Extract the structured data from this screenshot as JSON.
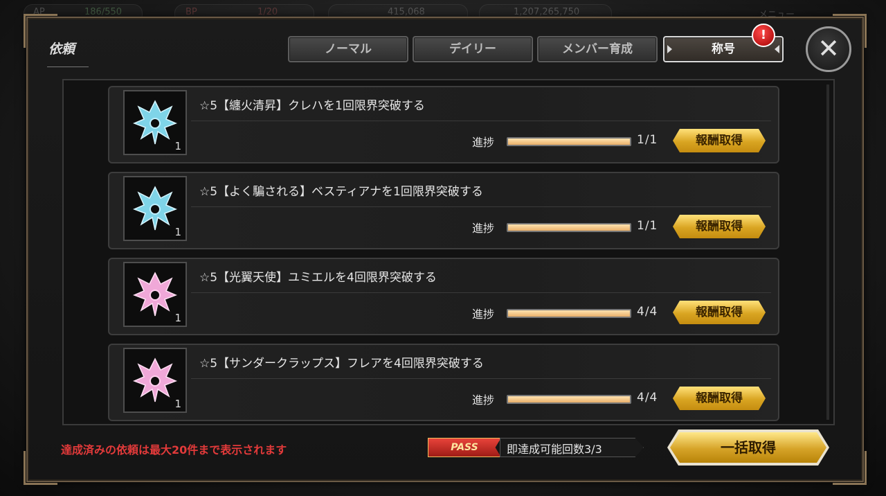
{
  "background_hud": {
    "ap_label": "AP",
    "ap_value": "186/550",
    "bp_label": "BP",
    "bp_value": "1/20",
    "currency_1": "415,068",
    "currency_2": "1,207,265,750",
    "menu_label": "メニュー"
  },
  "dialog": {
    "title": "依頼",
    "tabs": [
      {
        "label": "ノーマル",
        "active": false
      },
      {
        "label": "デイリー",
        "active": false
      },
      {
        "label": "メンバー育成",
        "active": false
      },
      {
        "label": "称号",
        "active": true
      }
    ],
    "alert_glyph": "!",
    "close_glyph": "✕"
  },
  "quests": [
    {
      "description": "☆5【纏火清昇】クレハを1回限界突破する",
      "icon": "crest-blue-icon",
      "icon_color": "#7fd4e8",
      "quantity": "1",
      "progress_label": "進捗",
      "progress_text": "1/1",
      "progress_fraction": 1.0,
      "claim_label": "報酬取得"
    },
    {
      "description": "☆5【よく騙される】ベスティアナを1回限界突破する",
      "icon": "crest-blue-icon",
      "icon_color": "#7fd4e8",
      "quantity": "1",
      "progress_label": "進捗",
      "progress_text": "1/1",
      "progress_fraction": 1.0,
      "claim_label": "報酬取得"
    },
    {
      "description": "☆5【光翼天使】ユミエルを4回限界突破する",
      "icon": "crest-pink-icon",
      "icon_color": "#f0a8d8",
      "quantity": "1",
      "progress_label": "進捗",
      "progress_text": "4/4",
      "progress_fraction": 1.0,
      "claim_label": "報酬取得"
    },
    {
      "description": "☆5【サンダークラップス】フレアを4回限界突破する",
      "icon": "crest-pink-icon",
      "icon_color": "#f0a8d8",
      "quantity": "1",
      "progress_label": "進捗",
      "progress_text": "4/4",
      "progress_fraction": 1.0,
      "claim_label": "報酬取得"
    }
  ],
  "footer": {
    "notice": "達成済みの依頼は最大20件まで表示されます",
    "pass_badge": "PASS",
    "pass_text": "即達成可能回数3/3",
    "bulk_claim": "一括取得"
  },
  "colors": {
    "notice_red": "#e23a3a",
    "gold_button": "#d9a522",
    "frame_bronze": "#6b5a45"
  }
}
